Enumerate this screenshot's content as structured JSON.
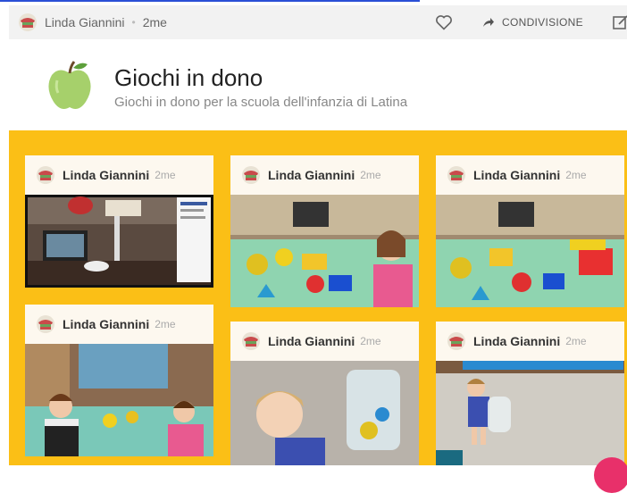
{
  "post": {
    "author": "Linda Giannini",
    "time": "2me",
    "share_label": "CONDIVISIONE"
  },
  "board": {
    "title": "Giochi in dono",
    "subtitle": "Giochi in dono per la scuola dell'infanzia di Latina"
  },
  "cards": [
    {
      "author": "Linda Giannini",
      "time": "2me"
    },
    {
      "author": "Linda Giannini",
      "time": "2me"
    },
    {
      "author": "Linda Giannini",
      "time": "2me"
    },
    {
      "author": "Linda Giannini",
      "time": "2me"
    },
    {
      "author": "Linda Giannini",
      "time": "2me"
    },
    {
      "author": "Linda Giannini",
      "time": "2me"
    }
  ],
  "colors": {
    "board_background": "#fbbf16",
    "topbar": "#f2f2f2",
    "card_header": "#fdf8ef"
  },
  "icons": [
    "avatar-icon",
    "heart-icon",
    "share-arrow-icon",
    "edit-icon",
    "apple-icon"
  ]
}
